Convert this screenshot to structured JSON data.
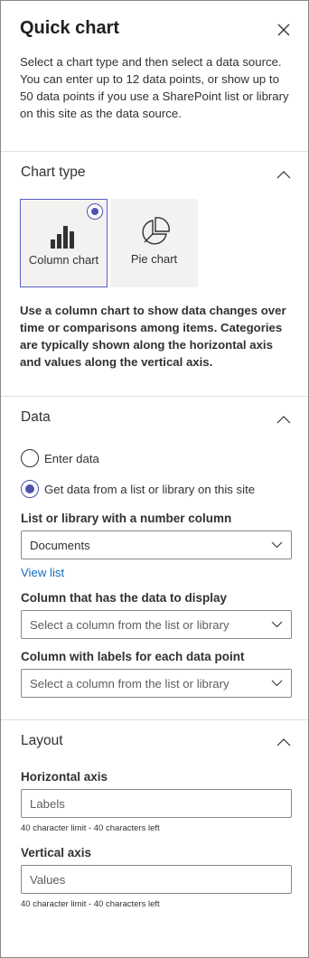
{
  "panel": {
    "title": "Quick chart",
    "description": "Select a chart type and then select a data source. You can enter up to 12 data points, or show up to 50 data points if you use a SharePoint list or library on this site as the data source."
  },
  "chart_type": {
    "heading": "Chart type",
    "options": [
      {
        "label": "Column chart",
        "icon": "column-chart-icon",
        "selected": true
      },
      {
        "label": "Pie chart",
        "icon": "pie-chart-icon",
        "selected": false
      }
    ],
    "description": "Use a column chart to show data changes over time or comparisons among items. Categories are typically shown along the horizontal axis and values along the vertical axis."
  },
  "data": {
    "heading": "Data",
    "radio_options": [
      {
        "label": "Enter data",
        "selected": false
      },
      {
        "label": "Get data from a list or library on this site",
        "selected": true
      }
    ],
    "list_label": "List or library with a number column",
    "list_value": "Documents",
    "view_list": "View list",
    "column_label": "Column that has the data to display",
    "column_placeholder": "Select a column from the list or library",
    "labels_label": "Column with labels for each data point",
    "labels_placeholder": "Select a column from the list or library"
  },
  "layout": {
    "heading": "Layout",
    "horizontal_label": "Horizontal axis",
    "horizontal_placeholder": "Labels",
    "horizontal_hint": "40 character limit - 40 characters left",
    "vertical_label": "Vertical axis",
    "vertical_placeholder": "Values",
    "vertical_hint": "40 character limit - 40 characters left"
  },
  "colors": {
    "accent": "#4f52b2",
    "link": "#0f6cbd",
    "border": "#8a8886",
    "divider": "#e1dfdd",
    "tile_bg": "#f3f2f1"
  }
}
